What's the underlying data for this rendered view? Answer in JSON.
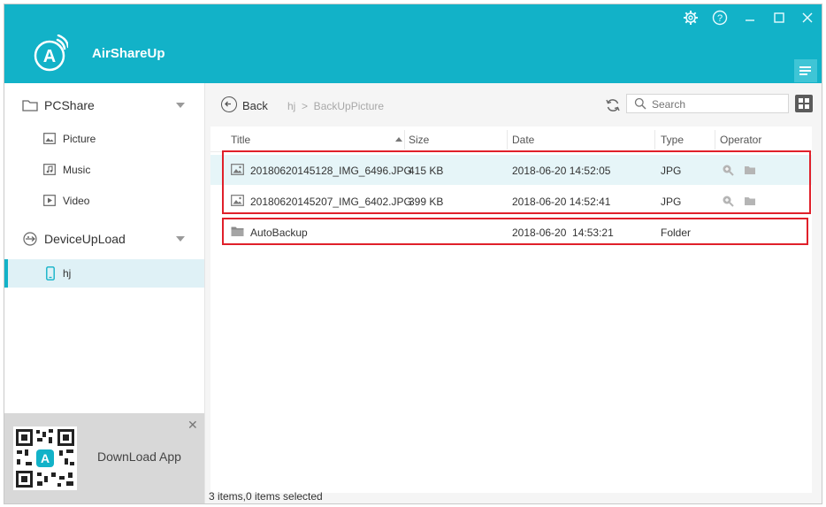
{
  "app": {
    "title": "AirShareUp",
    "logo_letter": "A",
    "colors": {
      "accent": "#12b2c8",
      "highlight_row": "#e6f5f8",
      "annotation_red": "#e0202a"
    },
    "window_controls": [
      "gear-icon",
      "help-icon",
      "minimize-icon",
      "maximize-icon",
      "close-icon"
    ]
  },
  "sidebar": {
    "groups": [
      {
        "label": "PCShare",
        "icon": "folder-icon",
        "expanded": true,
        "items": [
          {
            "label": "Picture",
            "icon": "picture-icon"
          },
          {
            "label": "Music",
            "icon": "music-icon"
          },
          {
            "label": "Video",
            "icon": "video-icon"
          }
        ]
      },
      {
        "label": "DeviceUpLoad",
        "icon": "usb-icon",
        "expanded": true,
        "items": [
          {
            "label": "hj",
            "icon": "phone-icon",
            "active": true
          }
        ]
      }
    ],
    "promo": {
      "label": "DownLoad App",
      "close": "✕"
    }
  },
  "toolbar": {
    "back_label": "Back",
    "breadcrumb": "hj  >  BackUpPicture",
    "search_placeholder": "Search"
  },
  "table": {
    "columns": [
      "Title",
      "Size",
      "Date",
      "Type",
      "Operator"
    ],
    "sort_column": "Title",
    "rows": [
      {
        "title": "20180620145128_IMG_6496.JPG",
        "size": "415 KB",
        "date": "2018-06-20 14:52:05",
        "type": "JPG",
        "icon": "image-file-icon",
        "operators": [
          "zoom-icon",
          "folder-icon"
        ]
      },
      {
        "title": "20180620145207_IMG_6402.JPG",
        "size": "399 KB",
        "date": "2018-06-20 14:52:41",
        "type": "JPG",
        "icon": "image-file-icon",
        "operators": [
          "zoom-icon",
          "folder-icon"
        ]
      },
      {
        "title": "AutoBackup",
        "size": "",
        "date": "2018-06-20  14:53:21",
        "type": "Folder",
        "icon": "folder-icon",
        "operators": []
      }
    ]
  },
  "status": {
    "text": "3 items,0 items selected"
  }
}
